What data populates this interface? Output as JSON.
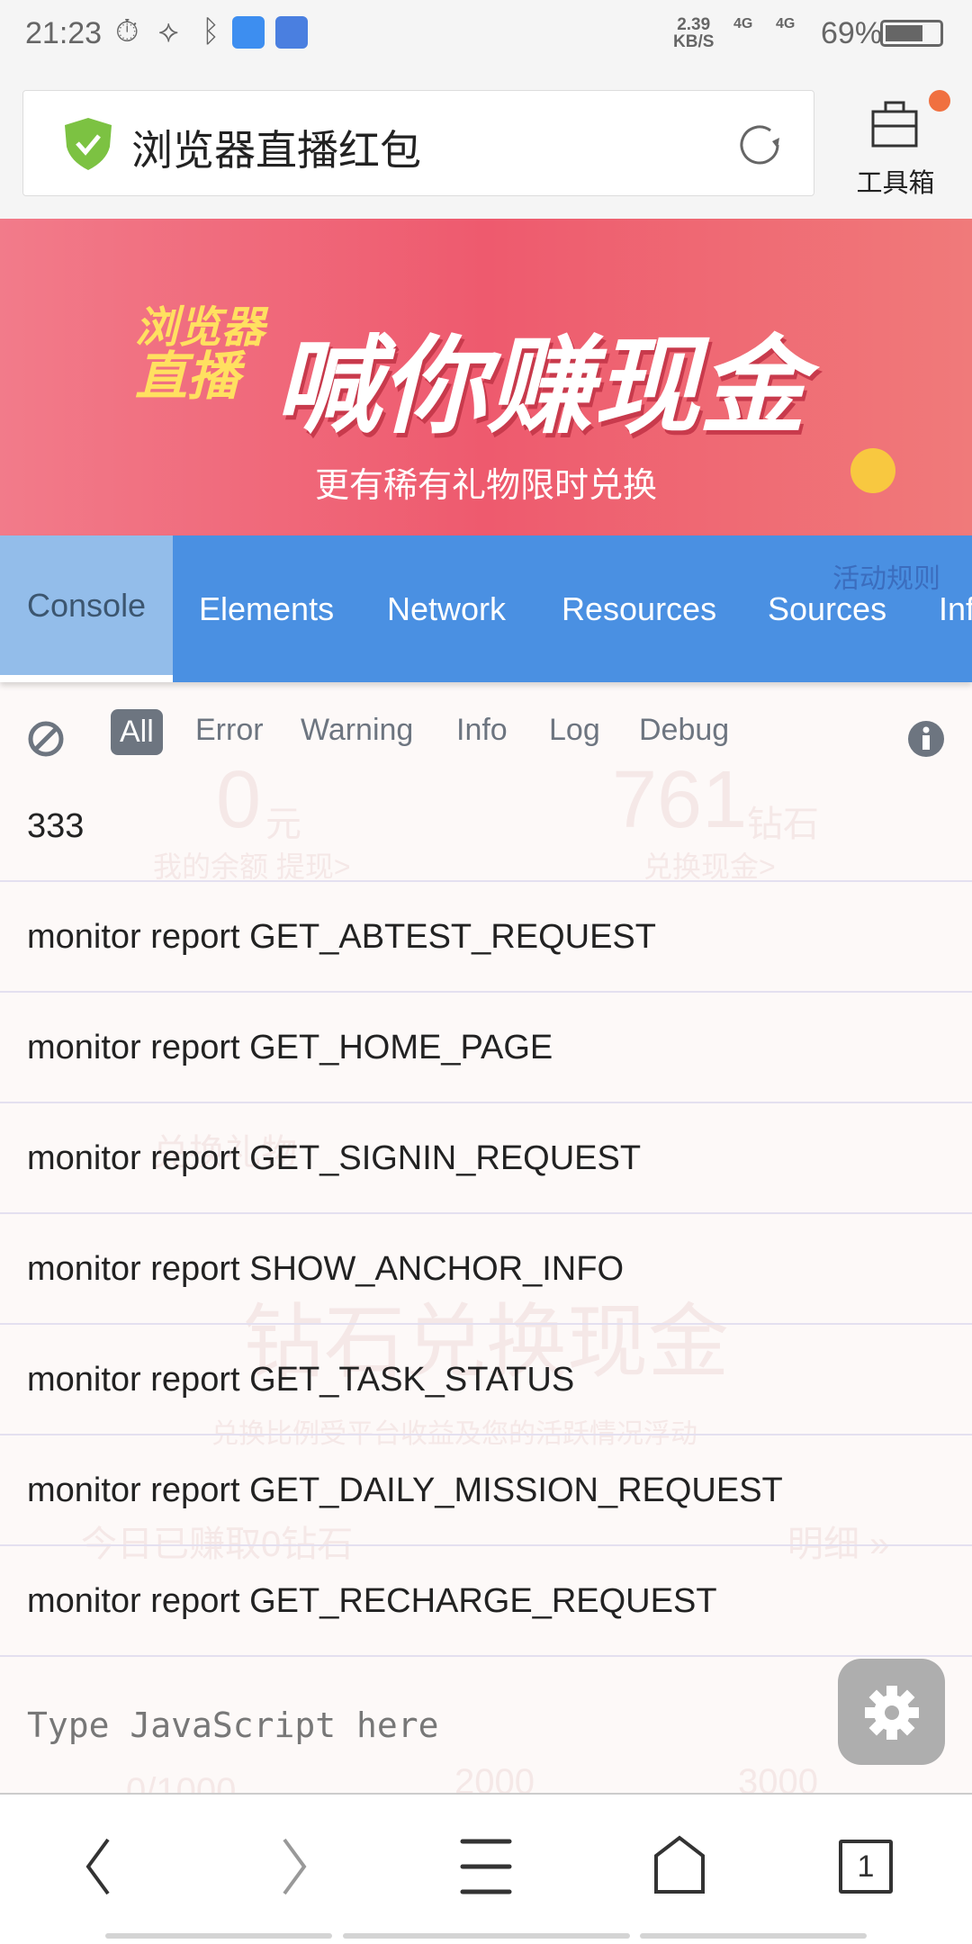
{
  "status_bar": {
    "time": "21:23",
    "net_speed": "2.39",
    "net_unit": "KB/S",
    "signal1": "4G",
    "signal2": "4G",
    "battery": "69%"
  },
  "url_bar": {
    "title": "浏览器直播红包"
  },
  "toolbox": {
    "label": "工具箱",
    "badge_color": "#f07040"
  },
  "banner": {
    "brand_line1": "浏览器",
    "brand_line2": "直播",
    "headline": "喊你赚现金",
    "subtitle": "更有稀有礼物限时兑换"
  },
  "background_page": {
    "rules": "活动规则",
    "balance": "0",
    "balance_unit": "元",
    "withdraw": "我的余额 提现>",
    "diamonds": "761",
    "diamonds_unit": "钻石",
    "exchange": "兑换现金>",
    "gift": "兑换礼物",
    "title": "钻石兑换现金",
    "note": "兑换比例受平台收益及您的活跃情况浮动",
    "earned": "今日已赚取0钻石",
    "detail": "明细 »",
    "p1": "0/1000",
    "p2": "2000",
    "p3": "3000"
  },
  "devtools": {
    "tabs": [
      {
        "label": "Console",
        "active": true
      },
      {
        "label": "Elements"
      },
      {
        "label": "Network"
      },
      {
        "label": "Resources"
      },
      {
        "label": "Sources"
      },
      {
        "label": "Info"
      }
    ],
    "filters": [
      {
        "label": "All",
        "active": true
      },
      {
        "label": "Error"
      },
      {
        "label": "Warning"
      },
      {
        "label": "Info"
      },
      {
        "label": "Log"
      },
      {
        "label": "Debug"
      }
    ],
    "logs": [
      "333",
      "monitor report GET_ABTEST_REQUEST",
      "monitor report GET_HOME_PAGE",
      "monitor report GET_SIGNIN_REQUEST",
      "monitor report SHOW_ANCHOR_INFO",
      "monitor report GET_TASK_STATUS",
      "monitor report GET_DAILY_MISSION_REQUEST",
      "monitor report GET_RECHARGE_REQUEST"
    ],
    "input_placeholder": "Type JavaScript here",
    "accent": "#4a90e2"
  },
  "bottom_nav": {
    "tab_count": "1"
  }
}
